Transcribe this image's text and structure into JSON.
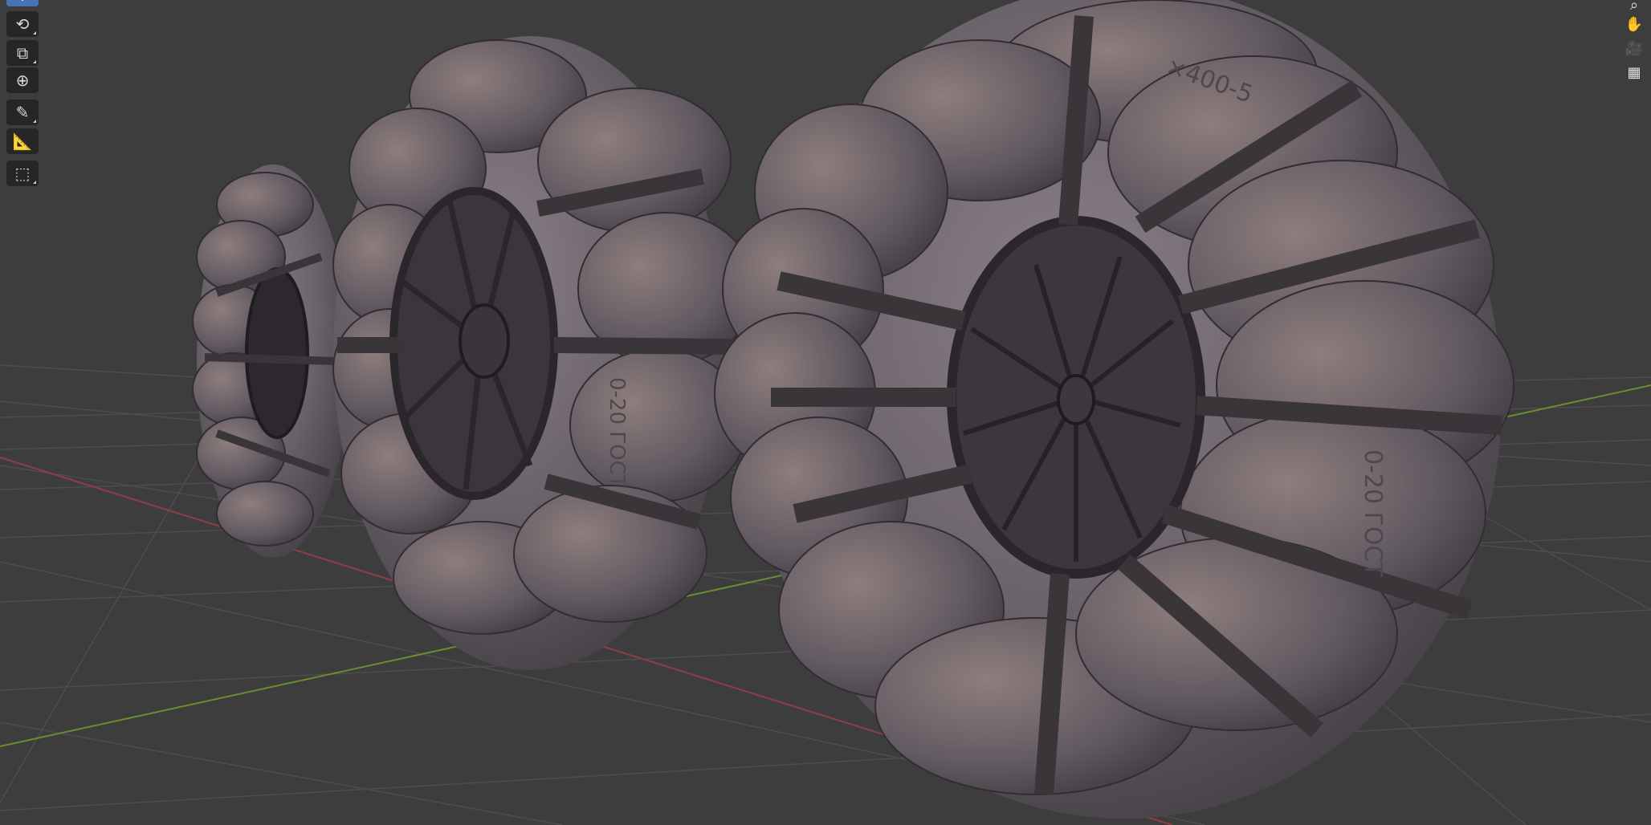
{
  "app": "Blender 3D Viewport",
  "toolbar": {
    "tools": [
      {
        "name": "move-tool-icon",
        "active": true
      },
      {
        "name": "rotate-tool-icon",
        "active": false
      },
      {
        "name": "scale-tool-icon",
        "active": false
      },
      {
        "name": "transform-tool-icon",
        "active": false
      },
      {
        "name": "annotate-tool-icon",
        "active": false
      },
      {
        "name": "measure-tool-icon",
        "active": false
      },
      {
        "name": "add-cube-tool-icon",
        "active": false
      }
    ]
  },
  "navigation": {
    "items": [
      {
        "name": "zoom-icon"
      },
      {
        "name": "pan-hand-icon"
      },
      {
        "name": "camera-view-icon"
      },
      {
        "name": "ortho-grid-icon"
      }
    ]
  },
  "scene": {
    "background": "#3d3d3d",
    "grid_color": "#4d4d4d",
    "x_axis_color": "#8f3e47",
    "y_axis_color": "#6a8d2f",
    "tire_color": "#6e6770",
    "band_color": "#3a3538",
    "tire_markings": [
      "×400-5",
      "0-20 ГОСТ"
    ]
  }
}
